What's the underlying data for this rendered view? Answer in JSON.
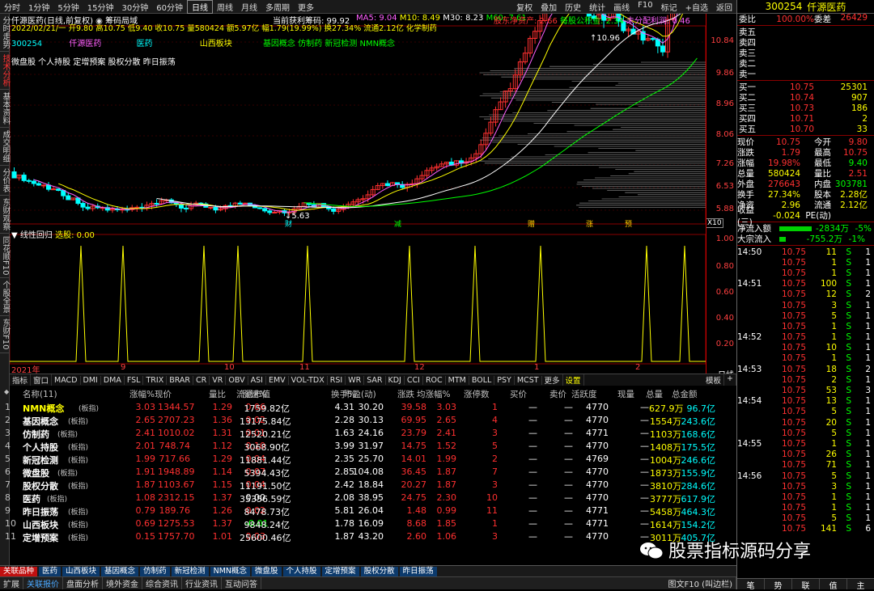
{
  "toolbar": {
    "periods": [
      "分时",
      "1分钟",
      "5分钟",
      "15分钟",
      "30分钟",
      "60分钟",
      "日线",
      "周线",
      "月线",
      "多周期",
      "更多"
    ],
    "active": "日线",
    "right": [
      "复权",
      "叠加",
      "历史",
      "统计",
      "画线",
      "F10",
      "标记",
      "+自选",
      "返回"
    ]
  },
  "left_tabs": [
    "分时走势",
    "技术分析",
    "基本资料",
    "成交明细",
    "分价表",
    "东财观察",
    "同花顺F10",
    "个股全景",
    "东财F10"
  ],
  "header": {
    "title": "仟源医药(日线,前复权)",
    "chip_btn": "筹码局域",
    "profit": "当前获利筹码: 99.92",
    "ma5": "MA5: 9.04",
    "ma10": "M10: 8.49",
    "ma30": "M30: 8.23",
    "ma60": "M60: 7.61",
    "info1": "股东净资产: 2.66",
    "info2": "每股公积金: 2.34",
    "info3": "未分配利润: 0.46",
    "date_line": "2022/02/21/一  开9.80  高10.75  低9.40  收10.75  量580424  额5.97亿  幅1.79(19.99%)  换27.34%  流通2.12亿  化学制药",
    "code": "300254",
    "name": "仟源医药",
    "sector1": "医药",
    "sector2": "山西板块",
    "concepts": "基因概念 仿制药 新冠检测 NMN概念",
    "concepts2": "微盘股 个人持股 定增预案 股权分散 昨日振荡",
    "high_label": "10.96",
    "low_label": "5.63",
    "marks": [
      "财",
      "减",
      "赠",
      "涨",
      "预"
    ]
  },
  "price_axis": [
    "10.84",
    "9.86",
    "8.96",
    "8.06",
    "7.26",
    "6.53",
    "5.88"
  ],
  "ind_axis": [
    "1.00",
    "0.80",
    "0.60",
    "0.40",
    "0.20"
  ],
  "indicator": {
    "title": "线性回归",
    "label": "选股: 0.00"
  },
  "time_labels": [
    "2021年",
    "9",
    "10",
    "11",
    "12",
    "1",
    "2",
    "日线"
  ],
  "ind_tabs": [
    "指标",
    "窗口",
    "MACD",
    "DMI",
    "DMA",
    "FSL",
    "TRIX",
    "BRAR",
    "CR",
    "VR",
    "OBV",
    "ASI",
    "EMV",
    "VOL-TDX",
    "RSI",
    "WR",
    "SAR",
    "KDJ",
    "CCI",
    "ROC",
    "MTM",
    "BOLL",
    "PSY",
    "MCST",
    "更多",
    "设置"
  ],
  "x10": "X10",
  "modbtns": [
    "模板",
    "+"
  ],
  "table": {
    "headers": [
      "名称(11)",
      "涨幅%",
      "现价",
      "量比",
      "涨速%",
      "流通市值",
      "换手%",
      "市盈(动)",
      "涨跌",
      "均涨幅%",
      "涨停数",
      "买价",
      "卖价",
      "活跃度",
      "现量",
      "总量",
      "总金额"
    ],
    "rows": [
      {
        "no": "1",
        "name": "NMN概念",
        "tag": "(板指)",
        "chg": "3.03",
        "price": "1344.57",
        "vr": "1.29",
        "spd": "0.06",
        "cap": "1759.82亿",
        "turn": "4.31",
        "pe": "30.20",
        "updown": "39.58",
        "avg": "3.03",
        "lim": "1",
        "bid": "—",
        "ask": "—",
        "act": "4770",
        "cur": "—",
        "vol": "627.9万",
        "amt": "96.7亿"
      },
      {
        "no": "2",
        "name": "基因概念",
        "tag": "(板指)",
        "chg": "2.65",
        "price": "2707.23",
        "vr": "1.36",
        "spd": "0.02",
        "cap": "13175.84亿",
        "turn": "2.28",
        "pe": "30.13",
        "updown": "69.95",
        "avg": "2.65",
        "lim": "4",
        "bid": "—",
        "ask": "—",
        "act": "4770",
        "cur": "—",
        "vol": "1554万",
        "amt": "243.6亿"
      },
      {
        "no": "3",
        "name": "仿制药",
        "tag": "(板指)",
        "chg": "2.41",
        "price": "1010.02",
        "vr": "1.31",
        "spd": "0.01",
        "cap": "12520.21亿",
        "turn": "1.63",
        "pe": "24.16",
        "updown": "23.79",
        "avg": "2.41",
        "lim": "3",
        "bid": "—",
        "ask": "—",
        "act": "4771",
        "cur": "—",
        "vol": "1103万",
        "amt": "168.6亿"
      },
      {
        "no": "4",
        "name": "个人持股",
        "tag": "(板指)",
        "chg": "2.01",
        "price": "748.74",
        "vr": "1.12",
        "spd": "0.10",
        "cap": "3068.90亿",
        "turn": "3.99",
        "pe": "31.97",
        "updown": "14.75",
        "avg": "1.52",
        "lim": "5",
        "bid": "—",
        "ask": "—",
        "act": "4770",
        "cur": "—",
        "vol": "1408万",
        "amt": "175.5亿"
      },
      {
        "no": "5",
        "name": "新冠检测",
        "tag": "(板指)",
        "chg": "1.99",
        "price": "717.66",
        "vr": "1.29",
        "spd": "0.04",
        "cap": "11881.44亿",
        "turn": "2.35",
        "pe": "25.70",
        "updown": "14.01",
        "avg": "1.99",
        "lim": "2",
        "bid": "—",
        "ask": "—",
        "act": "4769",
        "cur": "—",
        "vol": "1004万",
        "amt": "246.6亿"
      },
      {
        "no": "6",
        "name": "微盘股",
        "tag": "(板指)",
        "chg": "1.91",
        "price": "1948.89",
        "vr": "1.14",
        "spd": "0.07",
        "cap": "5394.43亿",
        "turn": "2.85",
        "pe": "104.08",
        "updown": "36.45",
        "avg": "1.87",
        "lim": "7",
        "bid": "—",
        "ask": "—",
        "act": "4770",
        "cur": "—",
        "vol": "1873万",
        "amt": "155.9亿"
      },
      {
        "no": "7",
        "name": "股权分散",
        "tag": "(板指)",
        "chg": "1.87",
        "price": "1103.67",
        "vr": "1.15",
        "spd": "0.04",
        "cap": "11191.50亿",
        "turn": "2.42",
        "pe": "18.84",
        "updown": "20.27",
        "avg": "1.87",
        "lim": "3",
        "bid": "—",
        "ask": "—",
        "act": "4770",
        "cur": "—",
        "vol": "3810万",
        "amt": "284.6亿"
      },
      {
        "no": "8",
        "name": "医药",
        "tag": "(板指)",
        "chg": "1.08",
        "price": "2312.15",
        "vr": "1.37",
        "spd": "0.00",
        "cap": "35356.59亿",
        "turn": "2.08",
        "pe": "38.95",
        "updown": "24.75",
        "avg": "2.30",
        "lim": "10",
        "bid": "—",
        "ask": "—",
        "act": "4770",
        "cur": "—",
        "vol": "3777万",
        "amt": "617.9亿"
      },
      {
        "no": "9",
        "name": "昨日振荡",
        "tag": "(板指)",
        "chg": "0.79",
        "price": "189.76",
        "vr": "1.26",
        "spd": "0.02",
        "cap": "8478.73亿",
        "turn": "5.81",
        "pe": "26.04",
        "updown": "1.48",
        "avg": "0.99",
        "lim": "11",
        "bid": "—",
        "ask": "—",
        "act": "4771",
        "cur": "—",
        "vol": "5458万",
        "amt": "464.3亿"
      },
      {
        "no": "10",
        "name": "山西板块",
        "tag": "(板指)",
        "chg": "0.69",
        "price": "1275.53",
        "vr": "1.37",
        "spd": "-0.01",
        "cap": "9848.24亿",
        "turn": "1.78",
        "pe": "16.09",
        "updown": "8.68",
        "avg": "1.85",
        "lim": "1",
        "bid": "—",
        "ask": "—",
        "act": "4771",
        "cur": "—",
        "vol": "1614万",
        "amt": "154.2亿"
      },
      {
        "no": "11",
        "name": "定增预案",
        "tag": "(板指)",
        "chg": "0.15",
        "price": "1757.70",
        "vr": "1.01",
        "spd": "0.03",
        "cap": "25600.46亿",
        "turn": "1.87",
        "pe": "43.20",
        "updown": "2.60",
        "avg": "1.06",
        "lim": "3",
        "bid": "—",
        "ask": "—",
        "act": "4770",
        "cur": "—",
        "vol": "3011万",
        "amt": "405.7亿"
      }
    ]
  },
  "bottom_tabs": [
    "关联品种",
    "医药",
    "山西板块",
    "基因概念",
    "仿制药",
    "新冠检测",
    "NMN概念",
    "微盘股",
    "个人持股",
    "定增预案",
    "股权分散",
    "昨日振荡"
  ],
  "status_tabs": [
    "扩展",
    "关联报价",
    "盘面分析",
    "境外资金",
    "综合资讯",
    "行业资讯",
    "互动问答"
  ],
  "right": {
    "code": "300254",
    "name": "仟源医药",
    "weibi_label": "委比",
    "weibi": "100.00%",
    "weicha_label": "委差",
    "weicha": "26429",
    "asks": [
      {
        "l": "卖五",
        "p": "",
        "v": ""
      },
      {
        "l": "卖四",
        "p": "",
        "v": ""
      },
      {
        "l": "卖三",
        "p": "",
        "v": ""
      },
      {
        "l": "卖二",
        "p": "",
        "v": ""
      },
      {
        "l": "卖一",
        "p": "",
        "v": ""
      }
    ],
    "bids": [
      {
        "l": "买一",
        "p": "10.75",
        "v": "25301"
      },
      {
        "l": "买二",
        "p": "10.74",
        "v": "907"
      },
      {
        "l": "买三",
        "p": "10.73",
        "v": "186"
      },
      {
        "l": "买四",
        "p": "10.71",
        "v": "2"
      },
      {
        "l": "买五",
        "p": "10.70",
        "v": "33"
      }
    ],
    "stats": [
      {
        "a": "现价",
        "b": "10.75",
        "c": "今开",
        "d": "9.80"
      },
      {
        "a": "涨跌",
        "b": "1.79",
        "c": "最高",
        "d": "10.75"
      },
      {
        "a": "涨幅",
        "b": "19.98%",
        "c": "最低",
        "d": "9.40"
      },
      {
        "a": "总量",
        "b": "580424",
        "c": "量比",
        "d": "2.51"
      },
      {
        "a": "外盘",
        "b": "276643",
        "c": "内盘",
        "d": "303781"
      },
      {
        "a": "换手",
        "b": "27.34%",
        "c": "股本",
        "d": "2.28亿"
      },
      {
        "a": "净资",
        "b": "2.96",
        "c": "流通",
        "d": "2.12亿"
      },
      {
        "a": "收益(三)",
        "b": "-0.024",
        "c": "PE(动)",
        "d": ""
      }
    ],
    "flow": [
      {
        "a": "净流入额",
        "b": "-2834万",
        "c": "-5%"
      },
      {
        "a": "大宗流入",
        "b": "-755.2万",
        "c": "-1%"
      }
    ],
    "ticks": [
      {
        "t": "14:50",
        "p": "10.75",
        "v": "11",
        "s": "S",
        "n": "1"
      },
      {
        "t": "",
        "p": "10.75",
        "v": "1",
        "s": "S",
        "n": "1"
      },
      {
        "t": "",
        "p": "10.75",
        "v": "1",
        "s": "S",
        "n": "1"
      },
      {
        "t": "14:51",
        "p": "10.75",
        "v": "100",
        "s": "S",
        "n": "1"
      },
      {
        "t": "",
        "p": "10.75",
        "v": "12",
        "s": "S",
        "n": "2"
      },
      {
        "t": "",
        "p": "10.75",
        "v": "3",
        "s": "S",
        "n": "1"
      },
      {
        "t": "",
        "p": "10.75",
        "v": "5",
        "s": "S",
        "n": "1"
      },
      {
        "t": "",
        "p": "10.75",
        "v": "1",
        "s": "S",
        "n": "1"
      },
      {
        "t": "14:52",
        "p": "10.75",
        "v": "1",
        "s": "S",
        "n": "1"
      },
      {
        "t": "",
        "p": "10.75",
        "v": "10",
        "s": "S",
        "n": "1"
      },
      {
        "t": "",
        "p": "10.75",
        "v": "1",
        "s": "S",
        "n": "1"
      },
      {
        "t": "14:53",
        "p": "10.75",
        "v": "18",
        "s": "S",
        "n": "2"
      },
      {
        "t": "",
        "p": "10.75",
        "v": "2",
        "s": "S",
        "n": "1"
      },
      {
        "t": "",
        "p": "10.75",
        "v": "53",
        "s": "S",
        "n": "3"
      },
      {
        "t": "14:54",
        "p": "10.75",
        "v": "13",
        "s": "S",
        "n": "1"
      },
      {
        "t": "",
        "p": "10.75",
        "v": "5",
        "s": "S",
        "n": "1"
      },
      {
        "t": "",
        "p": "10.75",
        "v": "20",
        "s": "S",
        "n": "1"
      },
      {
        "t": "",
        "p": "10.75",
        "v": "5",
        "s": "S",
        "n": "1"
      },
      {
        "t": "14:55",
        "p": "10.75",
        "v": "1",
        "s": "S",
        "n": "1"
      },
      {
        "t": "",
        "p": "10.75",
        "v": "26",
        "s": "S",
        "n": "1"
      },
      {
        "t": "",
        "p": "10.75",
        "v": "71",
        "s": "S",
        "n": "1"
      },
      {
        "t": "14:56",
        "p": "10.75",
        "v": "5",
        "s": "S",
        "n": "1"
      },
      {
        "t": "",
        "p": "10.75",
        "v": "3",
        "s": "S",
        "n": "1"
      },
      {
        "t": "",
        "p": "10.75",
        "v": "1",
        "s": "S",
        "n": "1"
      },
      {
        "t": "",
        "p": "10.75",
        "v": "1",
        "s": "S",
        "n": "1"
      },
      {
        "t": "",
        "p": "10.75",
        "v": "5",
        "s": "S",
        "n": "1"
      },
      {
        "t": "",
        "p": "10.75",
        "v": "141",
        "s": "S",
        "n": "6"
      }
    ],
    "bottom": [
      "笔",
      "势",
      "联",
      "值",
      "主"
    ]
  },
  "status_right": "图文F10 (叫边栏)",
  "watermark": "股票指标源码分享"
}
